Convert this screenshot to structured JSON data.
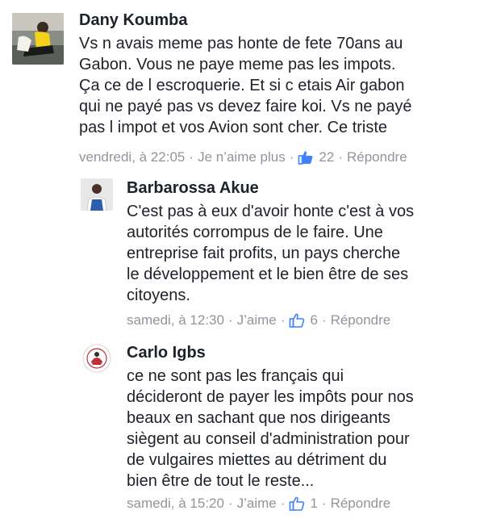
{
  "colors": {
    "text": "#1d2129",
    "meta": "#90949c",
    "like_blue": "#4080ff"
  },
  "comments": [
    {
      "author": "Dany Koumba",
      "text": "Vs n avais meme pas honte de fete 70ans au\nGabon. Vous ne paye meme pas les impots.\nÇa ce de l escroquerie. Et si c etais Air gabon\nqui ne payé pas vs devez faire koi. Vs ne payé\npas l impot et vos Avion sont cher. Ce triste",
      "time": "vendredi, à 22:05",
      "like_action": "Je n’aime plus",
      "like_count": "22",
      "reply": "Répondre"
    },
    {
      "author": "Barbarossa Akue",
      "text": "C'est pas à eux d'avoir honte c'est à  vos\nautorités  corrompus  de le faire. Une\nentreprise  fait profits, un pays cherche\nle développement  et le bien être de ses\ncitoyens.",
      "time": "samedi, à 12:30",
      "like_action": "J’aime",
      "like_count": "6",
      "reply": "Répondre"
    },
    {
      "author": "Carlo Igbs",
      "text": "ce ne sont pas les français qui\ndécideront de payer les impôts pour nos\nbeaux en sachant que nos dirigeants\nsiègent au conseil d'administration pour\nde vulgaires miettes au détriment du\nbien être de tout le reste...",
      "time": "samedi, à 15:20",
      "like_action": "J’aime",
      "like_count": "1",
      "reply": "Répondre"
    }
  ]
}
